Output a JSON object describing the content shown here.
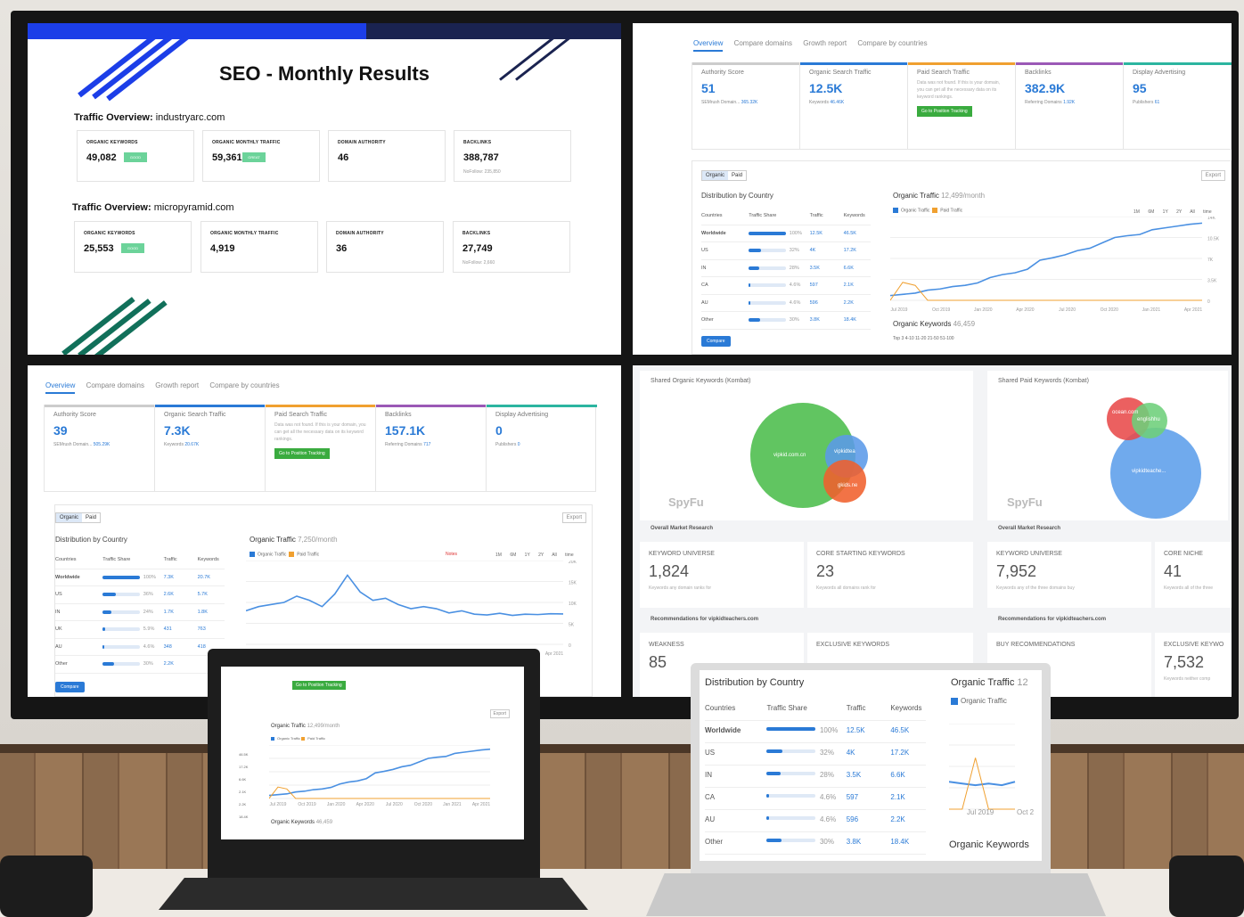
{
  "seo": {
    "title": "SEO - Monthly Results",
    "sites": [
      {
        "heading_prefix": "Traffic Overview:",
        "domain": "industryarc.com",
        "cards": [
          {
            "label": "ORGANIC KEYWORDS",
            "value": "49,082",
            "badge": "GOOD"
          },
          {
            "label": "ORGANIC MONTHLY TRAFFIC",
            "value": "59,361",
            "badge": "GREAT"
          },
          {
            "label": "DOMAIN AUTHORITY",
            "value": "46"
          },
          {
            "label": "BACKLINKS",
            "value": "388,787",
            "sub": "NoFollow: 235,850"
          }
        ]
      },
      {
        "heading_prefix": "Traffic Overview:",
        "domain": "micropyramid.com",
        "cards": [
          {
            "label": "ORGANIC KEYWORDS",
            "value": "25,553",
            "badge": "GOOD"
          },
          {
            "label": "ORGANIC MONTHLY TRAFFIC",
            "value": "4,919"
          },
          {
            "label": "DOMAIN AUTHORITY",
            "value": "36"
          },
          {
            "label": "BACKLINKS",
            "value": "27,749",
            "sub": "NoFollow: 2,660"
          }
        ]
      }
    ],
    "colors": {
      "blue": "#1c3ee8",
      "navy": "#1a2350",
      "green": "#11705a"
    }
  },
  "semrush_top": {
    "tabs": [
      "Overview",
      "Compare domains",
      "Growth report",
      "Compare by countries"
    ],
    "kpis": [
      {
        "label": "Authority Score",
        "value": "51",
        "sub": "SEMrush Domain...",
        "sub_value": "365.32K"
      },
      {
        "label": "Organic Search Traffic",
        "value": "12.5K",
        "sub": "Keywords",
        "sub_value": "46.46K"
      },
      {
        "label": "Paid Search Traffic",
        "note": "Data was not found. If this is your domain, you can get all the necessary data on its keyword rankings.",
        "button": "Go to Position Tracking"
      },
      {
        "label": "Backlinks",
        "value": "382.9K",
        "sub": "Referring Domains",
        "sub_value": "1.92K"
      },
      {
        "label": "Display Advertising",
        "value": "95",
        "sub": "Publishers",
        "sub_value": "61"
      }
    ],
    "toggle": [
      "Organic",
      "Paid"
    ],
    "export": "Export",
    "dist_title": "Distribution by Country",
    "dist_headers": [
      "Countries",
      "Traffic Share",
      "Traffic",
      "Keywords"
    ],
    "dist_rows": [
      {
        "country": "Worldwide",
        "share": "100%",
        "share_frac": 1.0,
        "traffic": "12.5K",
        "keywords": "46.5K"
      },
      {
        "country": "US",
        "share": "32%",
        "share_frac": 0.32,
        "traffic": "4K",
        "keywords": "17.2K"
      },
      {
        "country": "IN",
        "share": "28%",
        "share_frac": 0.28,
        "traffic": "3.5K",
        "keywords": "6.6K"
      },
      {
        "country": "CA",
        "share": "4.6%",
        "share_frac": 0.046,
        "traffic": "597",
        "keywords": "2.1K"
      },
      {
        "country": "AU",
        "share": "4.6%",
        "share_frac": 0.046,
        "traffic": "596",
        "keywords": "2.2K"
      },
      {
        "country": "Other",
        "share": "30%",
        "share_frac": 0.3,
        "traffic": "3.8K",
        "keywords": "18.4K"
      }
    ],
    "compare": "Compare",
    "chart_title": "Organic Traffic",
    "chart_title_value": "12,499/month",
    "legend": [
      "Organic Traffic",
      "Paid Traffic"
    ],
    "times": "1M 6M 1Y 2Y All time",
    "ticks_y": [
      "14K",
      "10.5K",
      "7K",
      "3.5K",
      "0"
    ],
    "keywords_title": "Organic Keywords",
    "keywords_value": "46,459",
    "kw_legend": "Top 3   4-10   11-20   21-50   51-100"
  },
  "semrush_bottom": {
    "tabs": [
      "Overview",
      "Compare domains",
      "Growth report",
      "Compare by countries"
    ],
    "kpis": [
      {
        "label": "Authority Score",
        "value": "39",
        "sub": "SEMrush Domain...",
        "sub_value": "505.29K"
      },
      {
        "label": "Organic Search Traffic",
        "value": "7.3K",
        "sub": "Keywords",
        "sub_value": "20.67K"
      },
      {
        "label": "Paid Search Traffic",
        "note": "Data was not found. If this is your domain, you can get all the necessary data on its keyword rankings.",
        "button": "Go to Position Tracking"
      },
      {
        "label": "Backlinks",
        "value": "157.1K",
        "sub": "Referring Domains",
        "sub_value": "717"
      },
      {
        "label": "Display Advertising",
        "value": "0",
        "sub": "Publishers",
        "sub_value": "0"
      }
    ],
    "toggle": [
      "Organic",
      "Paid"
    ],
    "export": "Export",
    "dist_title": "Distribution by Country",
    "dist_headers": [
      "Countries",
      "Traffic Share",
      "Traffic",
      "Keywords"
    ],
    "dist_rows": [
      {
        "country": "Worldwide",
        "share": "100%",
        "share_frac": 1.0,
        "traffic": "7.3K",
        "keywords": "20.7K"
      },
      {
        "country": "US",
        "share": "36%",
        "share_frac": 0.36,
        "traffic": "2.6K",
        "keywords": "5.7K"
      },
      {
        "country": "IN",
        "share": "24%",
        "share_frac": 0.24,
        "traffic": "1.7K",
        "keywords": "1.8K"
      },
      {
        "country": "UK",
        "share": "5.9%",
        "share_frac": 0.059,
        "traffic": "431",
        "keywords": "763"
      },
      {
        "country": "AU",
        "share": "4.6%",
        "share_frac": 0.046,
        "traffic": "348",
        "keywords": "418"
      },
      {
        "country": "Other",
        "share": "30%",
        "share_frac": 0.3,
        "traffic": "2.2K",
        "keywords": ""
      }
    ],
    "compare": "Compare",
    "chart_title": "Organic Traffic",
    "chart_title_value": "7,250/month",
    "legend": [
      "Organic Traffic",
      "Paid Traffic"
    ],
    "notes": "Notes",
    "times": "1M 6M 1Y 2Y All time",
    "ticks_y": [
      "20K",
      "15K",
      "10K",
      "5K",
      "0"
    ]
  },
  "x_ticks": [
    "Jul 2019",
    "Oct 2019",
    "Jan 2020",
    "Apr 2020",
    "Jul 2020",
    "Oct 2020",
    "Jan 2021",
    "Apr 2021"
  ],
  "spyfu": {
    "left": {
      "title": "Shared Organic Keywords (Kombat)",
      "circles": [
        "vipkid.com.cn",
        "vipkidtea",
        "gkids.ne"
      ],
      "brand": "SpyFu",
      "section": "Overall Market Research",
      "stats": [
        {
          "label": "KEYWORD UNIVERSE",
          "value": "1,824",
          "sub": "Keywords any domain ranks for"
        },
        {
          "label": "CORE STARTING KEYWORDS",
          "value": "23",
          "sub": "Keywords all domains rank for"
        }
      ],
      "reco": "Recommendations for vipkidteachers.com",
      "stats2": [
        {
          "label": "WEAKNESS",
          "value": "85"
        },
        {
          "label": "EXCLUSIVE KEYWORDS",
          "value": ""
        }
      ]
    },
    "right": {
      "title": "Shared Paid Keywords (Kombat)",
      "circles": [
        "vipkidteache...",
        "ocean.com",
        "englishhu"
      ],
      "brand": "SpyFu",
      "section": "Overall Market Research",
      "stats": [
        {
          "label": "KEYWORD UNIVERSE",
          "value": "7,952",
          "sub": "Keywords any of the three domains buy"
        },
        {
          "label": "CORE NICHE",
          "value": "41",
          "sub": "Keywords all of the three"
        }
      ],
      "reco": "Recommendations for vipkidteachers.com",
      "stats2": [
        {
          "label": "BUY RECOMMENDATIONS",
          "value": ""
        },
        {
          "label": "EXCLUSIVE KEYWO",
          "value": "7,532",
          "sub": "Keywords neither comp"
        }
      ]
    }
  },
  "laptop_left": {
    "button": "Go to Position Tracking",
    "export": "Export",
    "chart_title": "Organic Traffic",
    "chart_title_value": "12,499/month",
    "legend": [
      "Organic Traffic",
      "Paid Traffic"
    ],
    "keywords_title": "Organic Keywords",
    "keywords_value": "46,459",
    "side_values": [
      "46.5K",
      "17.2K",
      "6.6K",
      "2.1K",
      "2.2K",
      "18.4K"
    ]
  },
  "laptop_right": {
    "dist_title": "Distribution by Country",
    "headers": [
      "Countries",
      "Traffic Share",
      "Traffic",
      "Keywords"
    ],
    "rows": [
      {
        "country": "Worldwide",
        "share": "100%",
        "share_frac": 1.0,
        "traffic": "12.5K",
        "keywords": "46.5K"
      },
      {
        "country": "US",
        "share": "32%",
        "share_frac": 0.32,
        "traffic": "4K",
        "keywords": "17.2K"
      },
      {
        "country": "IN",
        "share": "28%",
        "share_frac": 0.28,
        "traffic": "3.5K",
        "keywords": "6.6K"
      },
      {
        "country": "CA",
        "share": "4.6%",
        "share_frac": 0.046,
        "traffic": "597",
        "keywords": "2.1K"
      },
      {
        "country": "AU",
        "share": "4.6%",
        "share_frac": 0.046,
        "traffic": "596",
        "keywords": "2.2K"
      },
      {
        "country": "Other",
        "share": "30%",
        "share_frac": 0.3,
        "traffic": "3.8K",
        "keywords": "18.4K"
      }
    ],
    "chart_title": "Organic Traffic",
    "chart_title_value": "12",
    "legend": "Organic Traffic",
    "x_ticks": [
      "Jul 2019",
      "Oct 2"
    ],
    "keywords_title": "Organic Keywords"
  }
}
